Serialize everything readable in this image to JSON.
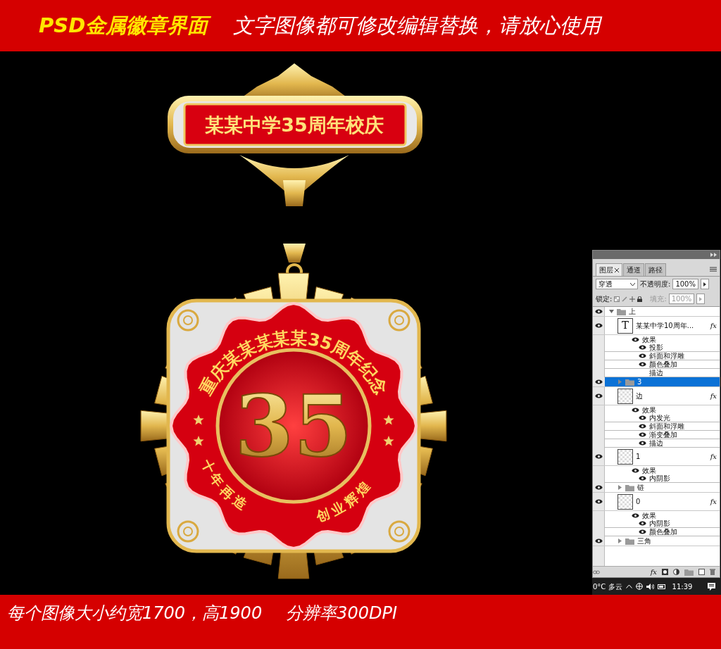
{
  "header": {
    "title": "PSD金属徽章界面",
    "tagline": "文字图像都可修改编辑替换，请放心使用"
  },
  "medal": {
    "banner": "某某中学35周年校庆",
    "ring": "重庆某某某某某35周年纪念",
    "number": "35",
    "motto_left": "十年再造",
    "motto_right": "创业辉煌"
  },
  "layers_panel": {
    "tabs": [
      {
        "label": "图层",
        "selected": true
      },
      {
        "label": "通道",
        "selected": false
      },
      {
        "label": "路径",
        "selected": false
      }
    ],
    "blend_mode": "穿透",
    "opacity_label": "不透明度:",
    "opacity": "100%",
    "lock_label": "锁定:",
    "fill_label": "填充:",
    "fill": "100%",
    "fill_disabled": true,
    "layers": [
      {
        "kind": "group",
        "name": "上",
        "visible": true,
        "selected": false,
        "expanded": true,
        "children": [
          {
            "kind": "text",
            "name": "某某中学10周年...",
            "thumb_glyph": "T",
            "badge": "fx",
            "visible": true,
            "selected": false,
            "effects": {
              "label": "效果",
              "items": [
                {
                  "name": "投影",
                  "visible": true
                },
                {
                  "name": "斜面和浮雕",
                  "visible": true
                },
                {
                  "name": "颜色叠加",
                  "visible": true
                },
                {
                  "name": "描边",
                  "visible": false
                }
              ]
            }
          },
          {
            "kind": "group",
            "name": "3",
            "visible": true,
            "selected": true,
            "expanded": false
          },
          {
            "kind": "raster",
            "name": "边",
            "badge": "fx",
            "visible": true,
            "selected": false,
            "effects": {
              "label": "效果",
              "items": [
                {
                  "name": "内发光",
                  "visible": true
                },
                {
                  "name": "斜面和浮雕",
                  "visible": true
                },
                {
                  "name": "渐变叠加",
                  "visible": true
                },
                {
                  "name": "描边",
                  "visible": true
                }
              ]
            }
          },
          {
            "kind": "raster",
            "name": "1",
            "badge": "fx",
            "visible": true,
            "selected": false,
            "effects": {
              "label": "效果",
              "items": [
                {
                  "name": "内阴影",
                  "visible": true
                }
              ]
            }
          },
          {
            "kind": "group",
            "name": "链",
            "visible": true,
            "selected": false,
            "expanded": false
          },
          {
            "kind": "raster",
            "name": "0",
            "badge": "fx",
            "visible": true,
            "selected": false,
            "effects": {
              "label": "效果",
              "items": [
                {
                  "name": "内阴影",
                  "visible": true
                },
                {
                  "name": "颜色叠加",
                  "visible": true
                }
              ]
            }
          },
          {
            "kind": "group",
            "name": "三角",
            "visible": true,
            "selected": false,
            "expanded": false
          }
        ]
      }
    ],
    "footer_fx": "fx"
  },
  "taskbar": {
    "weather": "0°C 多云",
    "time": "11:39"
  },
  "footer": {
    "size_note": "每个图像大小约宽1700，高1900",
    "resolution": "分辨率300DPI"
  }
}
